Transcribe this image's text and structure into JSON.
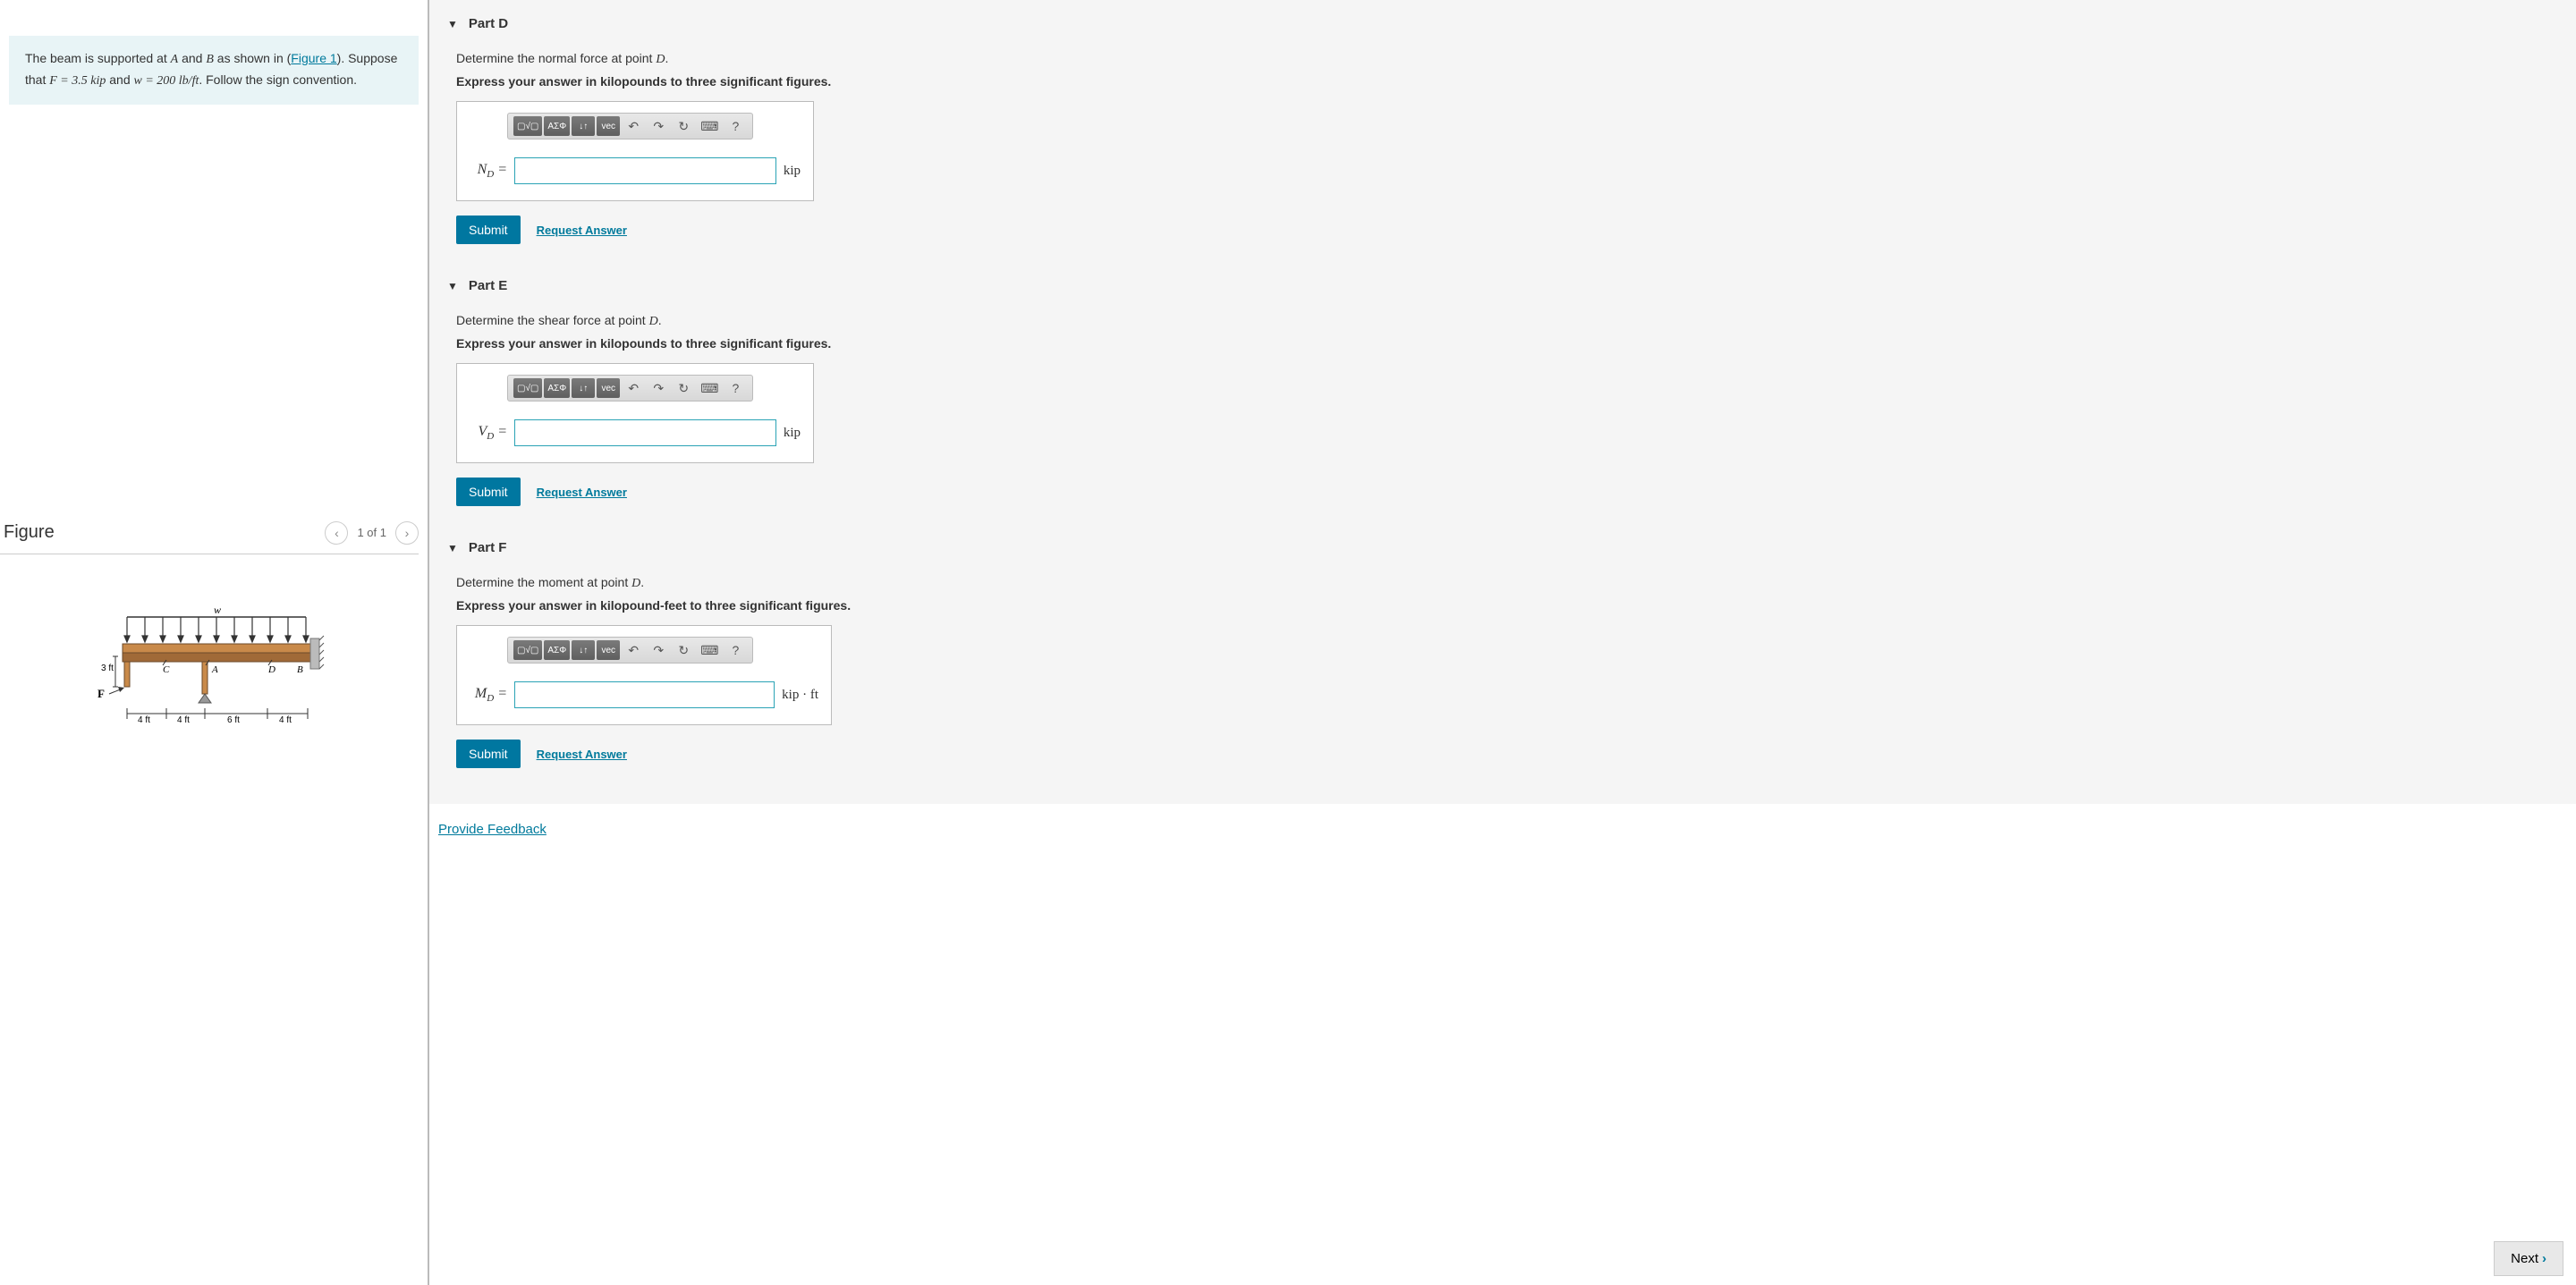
{
  "problem": {
    "text_before_link": "The beam is supported at ",
    "A": "A",
    "and": " and ",
    "B": "B",
    "shown_in": " as shown in (",
    "figure_link": "Figure 1",
    "after_link": "). Suppose that ",
    "F_eq": "F = 3.5 kip",
    "and_w": " and ",
    "w_eq": "w = 200 lb/ft",
    "follow": ". Follow the sign convention."
  },
  "figure": {
    "title": "Figure",
    "counter": "1 of 1",
    "labels": {
      "w": "w",
      "height": "3 ft",
      "C": "C",
      "A": "A",
      "D": "D",
      "B": "B",
      "F": "F",
      "d1": "4 ft",
      "d2": "4 ft",
      "d3": "6 ft",
      "d4": "4 ft"
    }
  },
  "parts": [
    {
      "key": "D",
      "title": "Part D",
      "prompt1_pre": "Determine the normal force at point ",
      "prompt1_var": "D",
      "prompt1_post": ".",
      "prompt2": "Express your answer in kilopounds to three significant figures.",
      "lhs_base": "N",
      "lhs_sub": "D",
      "unit": "kip"
    },
    {
      "key": "E",
      "title": "Part E",
      "prompt1_pre": "Determine the shear force at point ",
      "prompt1_var": "D",
      "prompt1_post": ".",
      "prompt2": "Express your answer in kilopounds to three significant figures.",
      "lhs_base": "V",
      "lhs_sub": "D",
      "unit": "kip"
    },
    {
      "key": "F",
      "title": "Part F",
      "prompt1_pre": "Determine the moment at point ",
      "prompt1_var": "D",
      "prompt1_post": ".",
      "prompt2": "Express your answer in kilopound-feet to three significant figures.",
      "lhs_base": "M",
      "lhs_sub": "D",
      "unit": "kip · ft"
    }
  ],
  "toolbar": {
    "templates": "▢√▢",
    "greek": "ΑΣΦ",
    "subscript": "↓↑",
    "vec": "vec",
    "undo": "↶",
    "redo": "↷",
    "reset": "↻",
    "keyboard": "⌨",
    "help": "?"
  },
  "buttons": {
    "submit": "Submit",
    "request": "Request Answer",
    "feedback": "Provide Feedback",
    "next": "Next"
  }
}
